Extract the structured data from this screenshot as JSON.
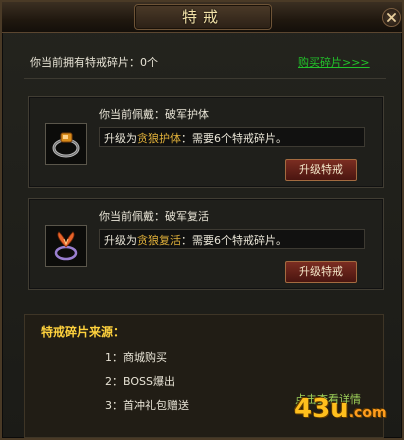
{
  "window": {
    "title": "特戒"
  },
  "fragments": {
    "text": "你当前拥有特戒碎片：0个",
    "buy_link": "购买碎片>>>"
  },
  "rings": [
    {
      "wearing": "你当前佩戴：破军护体",
      "upgrade_prefix": "升级为",
      "upgrade_target": "贪狼护体",
      "upgrade_suffix": "：需要6个特戒碎片。",
      "button": "升级特戒",
      "icon": "ring-amber-icon"
    },
    {
      "wearing": "你当前佩戴：破军复活",
      "upgrade_prefix": "升级为",
      "upgrade_target": "贪狼复活",
      "upgrade_suffix": "：需要6个特戒碎片。",
      "button": "升级特戒",
      "icon": "ring-phoenix-icon"
    }
  ],
  "sources": {
    "title": "特戒碎片来源：",
    "items": [
      "1：商城购买",
      "2：BOSS爆出",
      "3：首冲礼包赠送"
    ],
    "detail_link": "点击查看详情"
  },
  "brand": {
    "name": "43u",
    "suffix": ".com"
  },
  "colors": {
    "accent_green": "#22c12a",
    "highlight": "#e0b03a",
    "title_gold": "#ffd23d"
  }
}
